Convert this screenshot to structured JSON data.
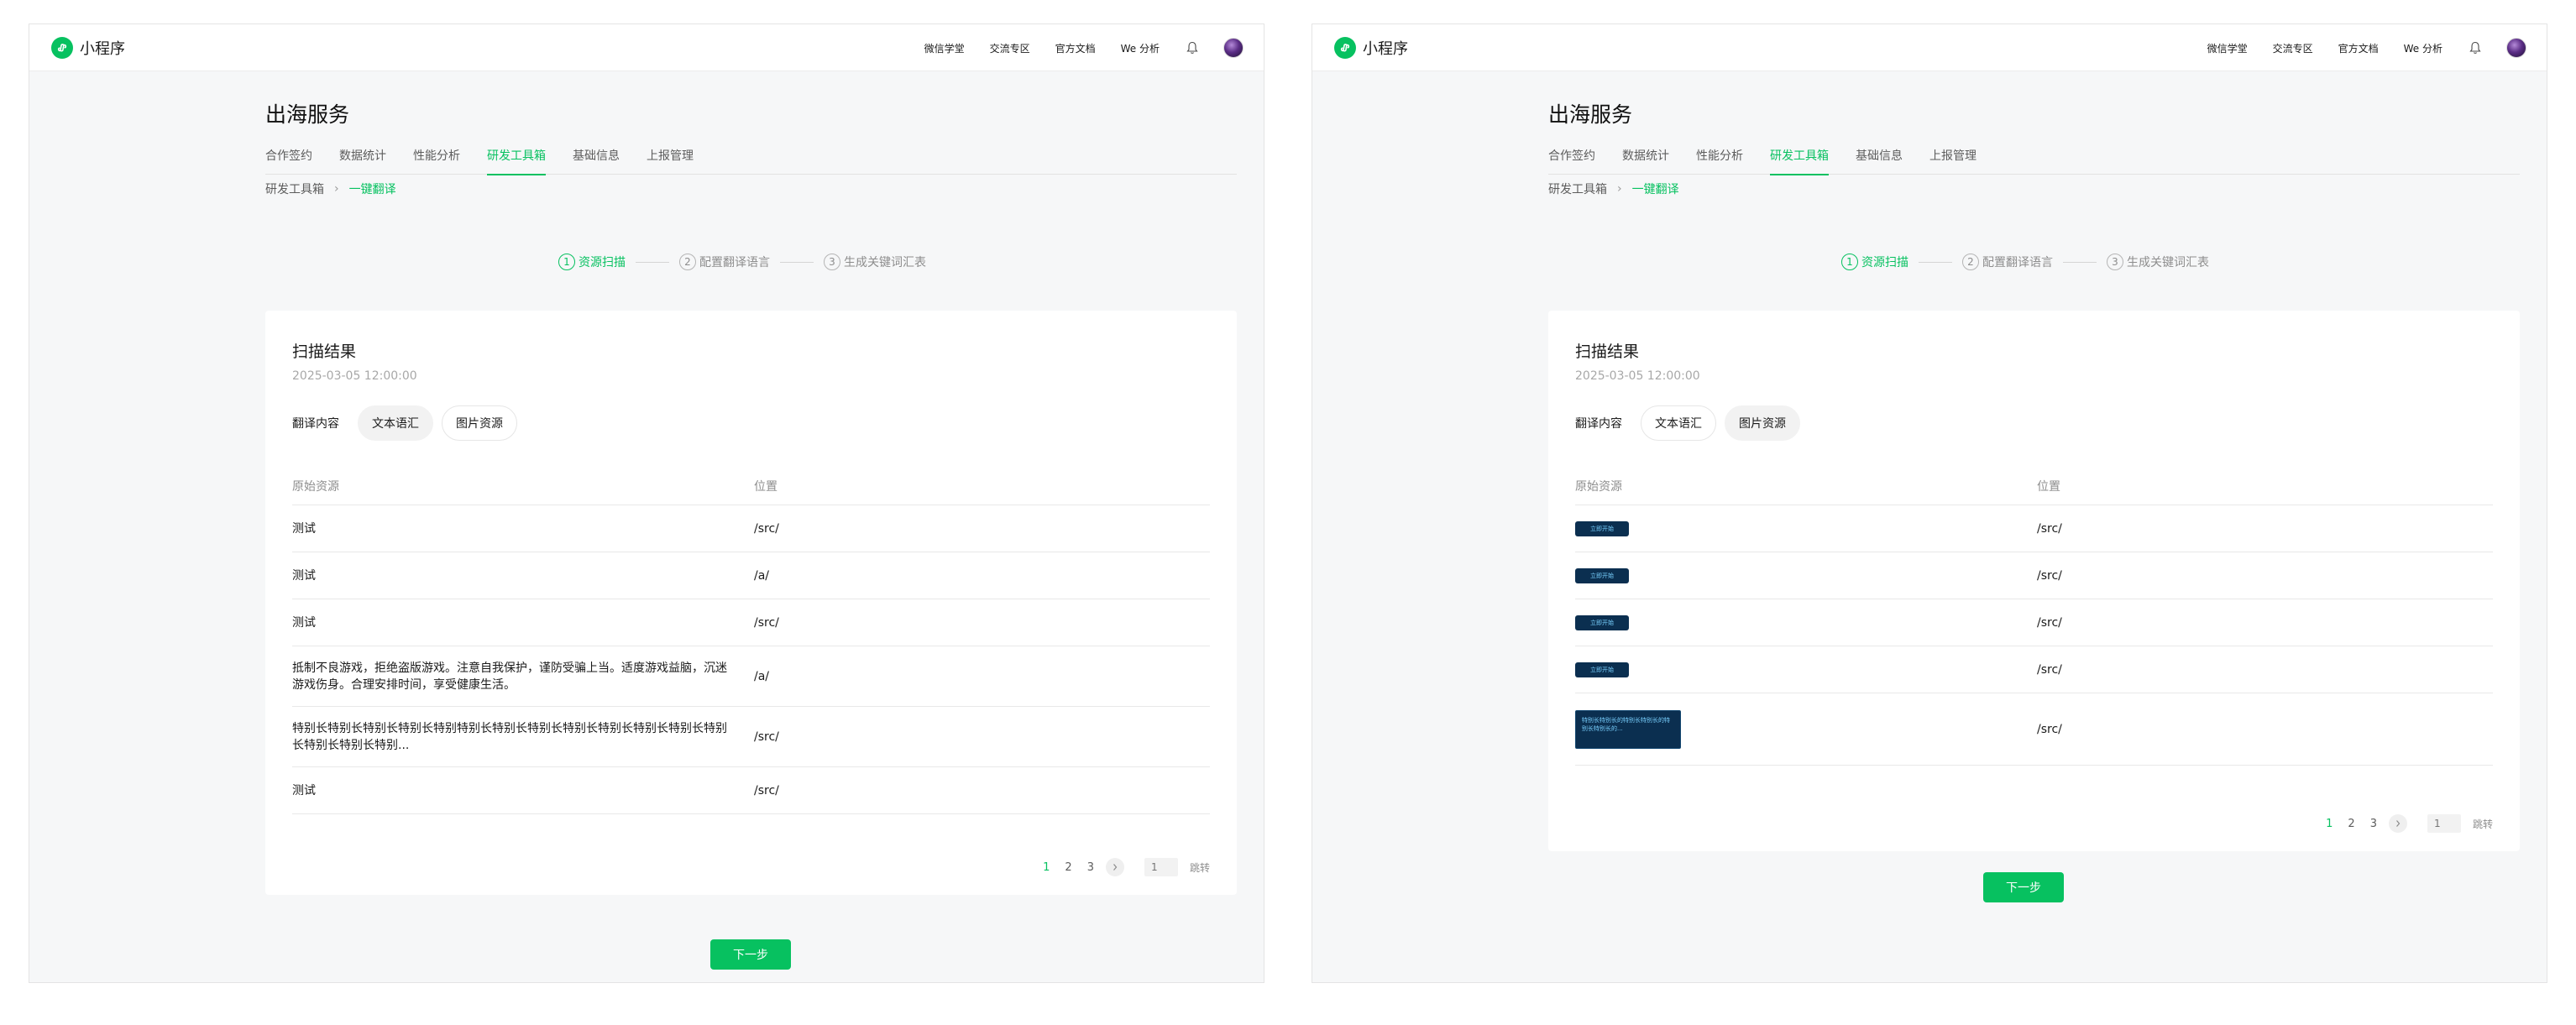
{
  "header": {
    "brand": "小程序",
    "nav": [
      "微信学堂",
      "交流专区",
      "官方文档",
      "We 分析"
    ]
  },
  "page": {
    "title": "出海服务",
    "tabs": [
      "合作签约",
      "数据统计",
      "性能分析",
      "研发工具箱",
      "基础信息",
      "上报管理"
    ],
    "active_tab": "研发工具箱",
    "breadcrumb": [
      "研发工具箱",
      "一键翻译"
    ]
  },
  "steps": [
    {
      "num": "1",
      "label": "资源扫描",
      "active": true
    },
    {
      "num": "2",
      "label": "配置翻译语言",
      "active": false
    },
    {
      "num": "3",
      "label": "生成关键词汇表",
      "active": false
    }
  ],
  "colors": {
    "accent": "#07c160",
    "thumbnail_bg": "#0b2f50"
  },
  "panels": [
    {
      "card": {
        "title": "扫描结果",
        "time": "2025-03-05  12:00:00",
        "filter_label": "翻译内容",
        "chips": [
          "文本语汇",
          "图片资源"
        ],
        "selected_chip": "文本语汇"
      },
      "table": {
        "headers": [
          "原始资源",
          "位置"
        ],
        "rows": [
          {
            "source": "测试",
            "location": "/src/"
          },
          {
            "source": "测试",
            "location": "/a/"
          },
          {
            "source": "测试",
            "location": "/src/"
          },
          {
            "source": "抵制不良游戏，拒绝盗版游戏。注意自我保护，谨防受骗上当。适度游戏益脑，沉迷游戏伤身。合理安排时间，享受健康生活。",
            "location": "/a/"
          },
          {
            "source": "特别长特别长特别长特别长特别特别长特别长特别长特别长特别长特别长特别长特别长特别长特别长特别...",
            "location": "/src/"
          },
          {
            "source": "测试",
            "location": "/src/"
          }
        ]
      },
      "pagination": {
        "pages": [
          "1",
          "2",
          "3"
        ],
        "current": "1",
        "input_placeholder": "1",
        "jump_label": "跳转"
      },
      "next_button": "下一步"
    },
    {
      "card": {
        "title": "扫描结果",
        "time": "2025-03-05  12:00:00",
        "filter_label": "翻译内容",
        "chips": [
          "文本语汇",
          "图片资源"
        ],
        "selected_chip": "图片资源"
      },
      "table": {
        "headers": [
          "原始资源",
          "位置"
        ],
        "rows": [
          {
            "thumb_text": "立即开始",
            "location": "/src/"
          },
          {
            "thumb_text": "立即开始",
            "location": "/src/"
          },
          {
            "thumb_text": "立即开始",
            "location": "/src/"
          },
          {
            "thumb_text": "立即开始",
            "location": "/src/"
          },
          {
            "thumb_text": "特别长特别长的特别长特别长的特别长特别长的...",
            "location": "/src/"
          }
        ]
      },
      "pagination": {
        "pages": [
          "1",
          "2",
          "3"
        ],
        "current": "1",
        "input_placeholder": "1",
        "jump_label": "跳转"
      },
      "next_button": "下一步"
    }
  ]
}
